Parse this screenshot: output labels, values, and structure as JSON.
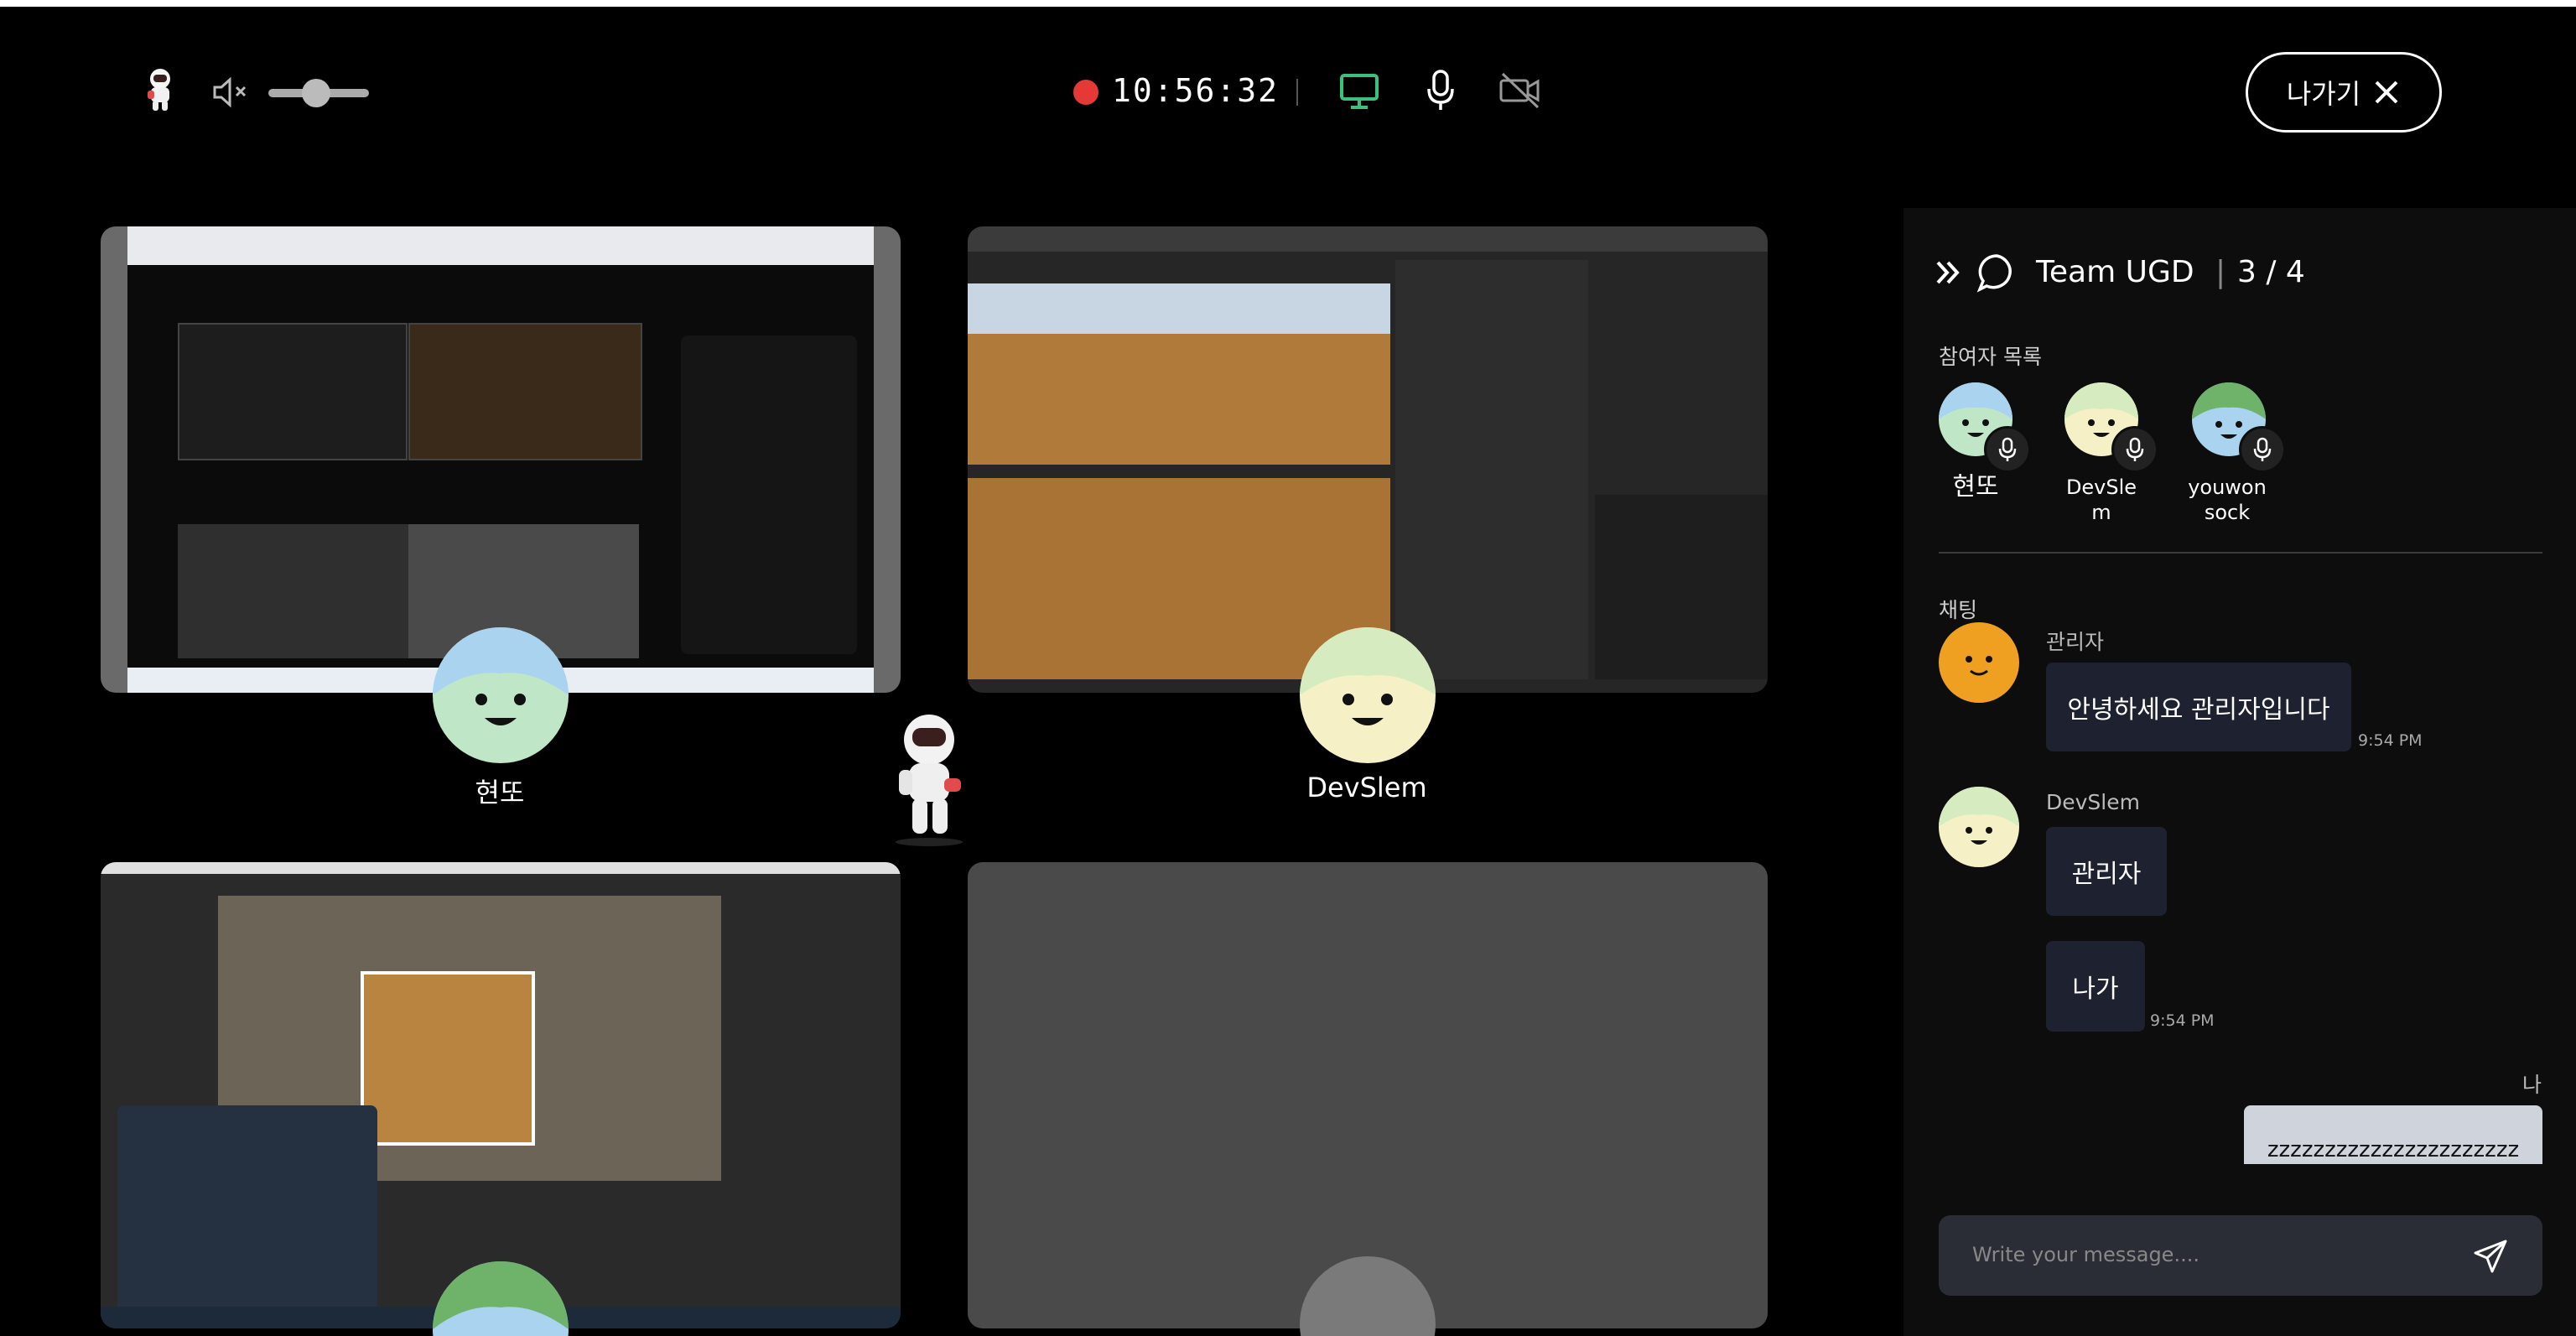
{
  "topbar": {
    "recording_time": "10:56:32",
    "exit_label": "나가기"
  },
  "tiles": [
    {
      "name": "현또"
    },
    {
      "name": "DevSlem"
    }
  ],
  "chat_panel": {
    "team": "Team UGD",
    "count": "3 / 4",
    "participants_label": "참여자 목록",
    "participants": [
      {
        "name": "현또"
      },
      {
        "name": "DevSle\nm"
      },
      {
        "name": "youwon\nsock"
      }
    ],
    "chat_label": "채팅",
    "messages": [
      {
        "sender": "관리자",
        "text": "안녕하세요 관리자입니다",
        "time": "9:54 PM"
      },
      {
        "sender": "DevSlem",
        "text": "관리자",
        "time": ""
      },
      {
        "sender": "",
        "text": "나가",
        "time": "9:54 PM"
      },
      {
        "sender": "나",
        "text": "zzzzzzzzzzzzzzzzzzzzzz",
        "time": ""
      }
    ],
    "input_placeholder": "Write your message...."
  },
  "colors": {
    "accent_green": "#3fbf7f",
    "record_red": "#e53935",
    "face_green": "#bfe6c7",
    "face_cream": "#f6f0c6",
    "face_blue": "#a9d3ef",
    "face_orange": "#f0a020"
  }
}
